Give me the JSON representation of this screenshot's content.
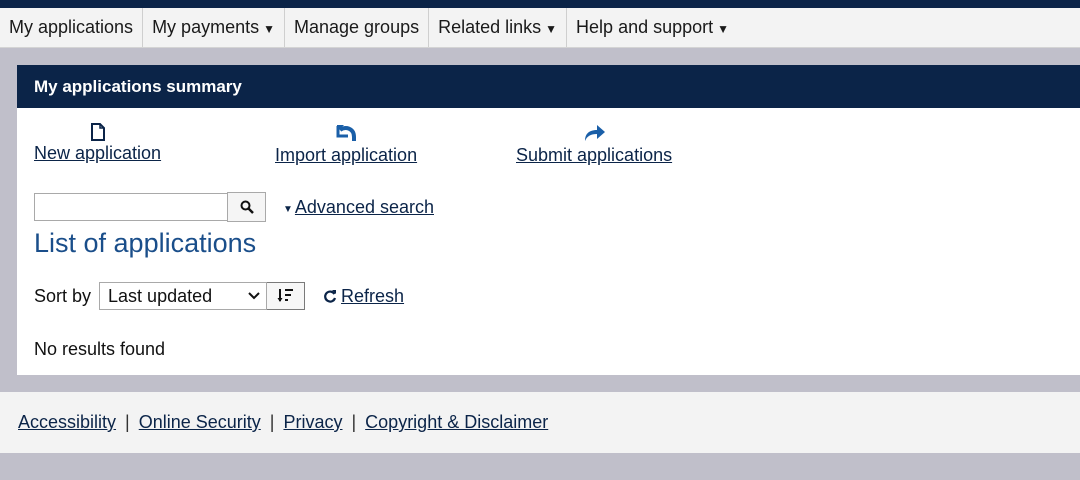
{
  "nav": {
    "items": [
      {
        "label": "My applications",
        "dropdown": false
      },
      {
        "label": "My payments",
        "dropdown": true
      },
      {
        "label": "Manage groups",
        "dropdown": false
      },
      {
        "label": "Related links",
        "dropdown": true
      },
      {
        "label": "Help and support",
        "dropdown": true
      }
    ],
    "caret": "▼"
  },
  "panel": {
    "title": "My applications summary",
    "actions": [
      {
        "label": "New application",
        "icon": "new-document-icon"
      },
      {
        "label": "Import application",
        "icon": "import-arrow-icon"
      },
      {
        "label": "Submit applications",
        "icon": "share-arrow-icon"
      }
    ]
  },
  "search": {
    "value": "",
    "placeholder": "",
    "advanced_label": "Advanced search",
    "advanced_caret": "▼"
  },
  "list": {
    "title": "List of applications",
    "sort_label": "Sort by",
    "sort_selected": "Last updated",
    "refresh_label": "Refresh",
    "empty_message": "No results found"
  },
  "footer": {
    "links": [
      "Accessibility",
      "Online Security",
      "Privacy",
      "Copyright & Disclaimer"
    ],
    "separator": "|"
  },
  "colors": {
    "navy": "#0b2448",
    "title_blue": "#1a4e8a",
    "page_bg": "#c0bfca",
    "bar_bg": "#f3f3f3"
  }
}
